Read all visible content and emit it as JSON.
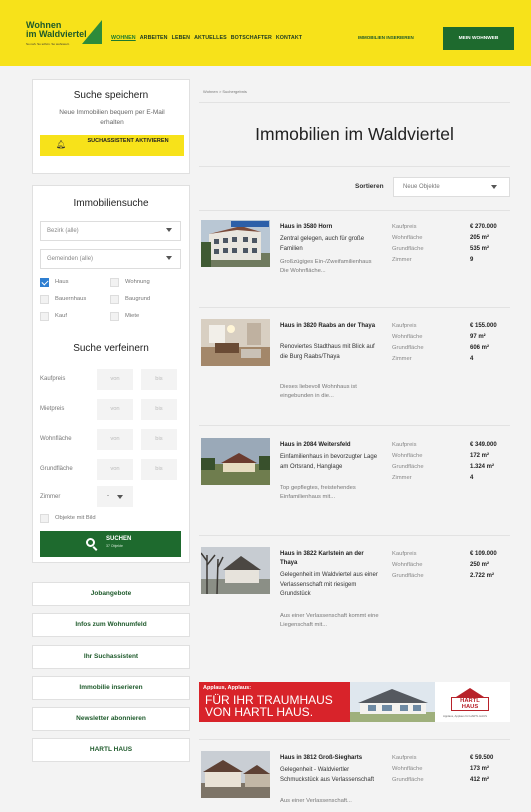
{
  "header": {
    "logo_line1": "Wohnen",
    "logo_line2": "im Waldviertel",
    "logo_tagline": "So nah. So schön. So wohnwert.",
    "nav": [
      "WOHNEN",
      "ARBEITEN",
      "LEBEN",
      "AKTUELLES",
      "BOTSCHAFTER",
      "KONTAKT"
    ],
    "insert_label": "IMMOBILIEN INSERIEREN",
    "mein_label": "MEIN WOHNWEB"
  },
  "save_search": {
    "title": "Suche speichern",
    "text": "Neue Immobilien bequem per E-Mail erhalten",
    "button": "SUCHASSISTENT AKTIVIEREN"
  },
  "search": {
    "title": "Immobiliensuche",
    "bezirk": "Bezirk (alle)",
    "gemeinden": "Gemeinden (alle)",
    "types": [
      {
        "label": "Haus",
        "checked": true
      },
      {
        "label": "Wohnung",
        "checked": false
      },
      {
        "label": "Bauernhaus",
        "checked": false
      },
      {
        "label": "Baugrund",
        "checked": false
      },
      {
        "label": "Kauf",
        "checked": false
      },
      {
        "label": "Miete",
        "checked": false
      }
    ],
    "refine_title": "Suche verfeinern",
    "ranges": [
      "Kaufpreis",
      "Mietpreis",
      "Wohnfläche",
      "Grundfläche"
    ],
    "von": "von",
    "bis": "bis",
    "zimmer_label": "Zimmer",
    "zimmer_value": "-",
    "image_only": "Objekte mit Bild",
    "button": "SUCHEN",
    "button_sub": "37 Objekte"
  },
  "side_links": [
    "Jobangebote",
    "Infos zum Wohnumfeld",
    "Ihr Suchassistent",
    "Immobilie inserieren",
    "Newsletter abonnieren",
    "HARTL HAUS"
  ],
  "main": {
    "breadcrumb": "Wohnen > Suchergebnis",
    "title": "Immobilien im Waldviertel",
    "sort_label": "Sortieren",
    "sort_value": "Neue Objekte"
  },
  "listings": [
    {
      "title": "Haus in 3580 Horn",
      "desc": "Zentral gelegen, auch für große Familien",
      "desc2": "Großzügiges Ein-/Zweifamilienhaus Die Wohnfläche...",
      "facts": [
        [
          "Kaufpreis",
          "€ 270.000"
        ],
        [
          "Wohnfläche",
          "205 m²"
        ],
        [
          "Grundfläche",
          "535 m²"
        ],
        [
          "Zimmer",
          "9"
        ]
      ]
    },
    {
      "title": "Haus in 3820 Raabs an der Thaya",
      "desc": "Renoviertes Stadthaus mit Blick auf die Burg Raabs/Thaya",
      "desc2": "Dieses liebevoll Wohnhaus ist eingebunden in die...",
      "facts": [
        [
          "Kaufpreis",
          "€ 155.000"
        ],
        [
          "Wohnfläche",
          "97 m²"
        ],
        [
          "Grundfläche",
          "606 m²"
        ],
        [
          "Zimmer",
          "4"
        ]
      ]
    },
    {
      "title": "Haus in 2084 Weitersfeld",
      "desc": "Einfamilienhaus in bevorzugter Lage am Ortsrand, Hanglage",
      "desc2": "Top gepflegtes, freistehendes Einfamilienhaus mit...",
      "facts": [
        [
          "Kaufpreis",
          "€ 349.000"
        ],
        [
          "Wohnfläche",
          "172 m²"
        ],
        [
          "Grundfläche",
          "1.324 m²"
        ],
        [
          "Zimmer",
          "4"
        ]
      ]
    },
    {
      "title": "Haus in 3822 Karlstein an der Thaya",
      "desc": "Gelegenheit im Waldviertel aus einer Verlassenschaft mit riesigem Grundstück",
      "desc2": "Aus einer Verlassenschaft kommt eine Liegenschaft mit...",
      "facts": [
        [
          "Kaufpreis",
          "€ 109.000"
        ],
        [
          "Wohnfläche",
          "250 m²"
        ],
        [
          "Grundfläche",
          "2.722 m²"
        ]
      ]
    },
    {
      "title": "Haus in 3812 Groß-Siegharts",
      "desc": "Gelegenheit - Waldviertler Schmuckstück aus Verlassenschaft",
      "desc2": "Aus einer Verlassenschaft...",
      "facts": [
        [
          "Kaufpreis",
          "€ 59.500"
        ],
        [
          "Wohnfläche",
          "173 m²"
        ],
        [
          "Grundfläche",
          "412 m²"
        ]
      ]
    }
  ],
  "ad": {
    "line1": "Applaus, Applaus:",
    "line2": "FÜR IHR TRAUMHAUS",
    "line3": "VON HARTL HAUS.",
    "logo": "HARTL HAUS",
    "tagline": "Applaus, Applaus für HARTL HAUS"
  },
  "colors": {
    "yellow": "#f7e21a",
    "green": "#1e6a2e",
    "red": "#d8232a"
  }
}
